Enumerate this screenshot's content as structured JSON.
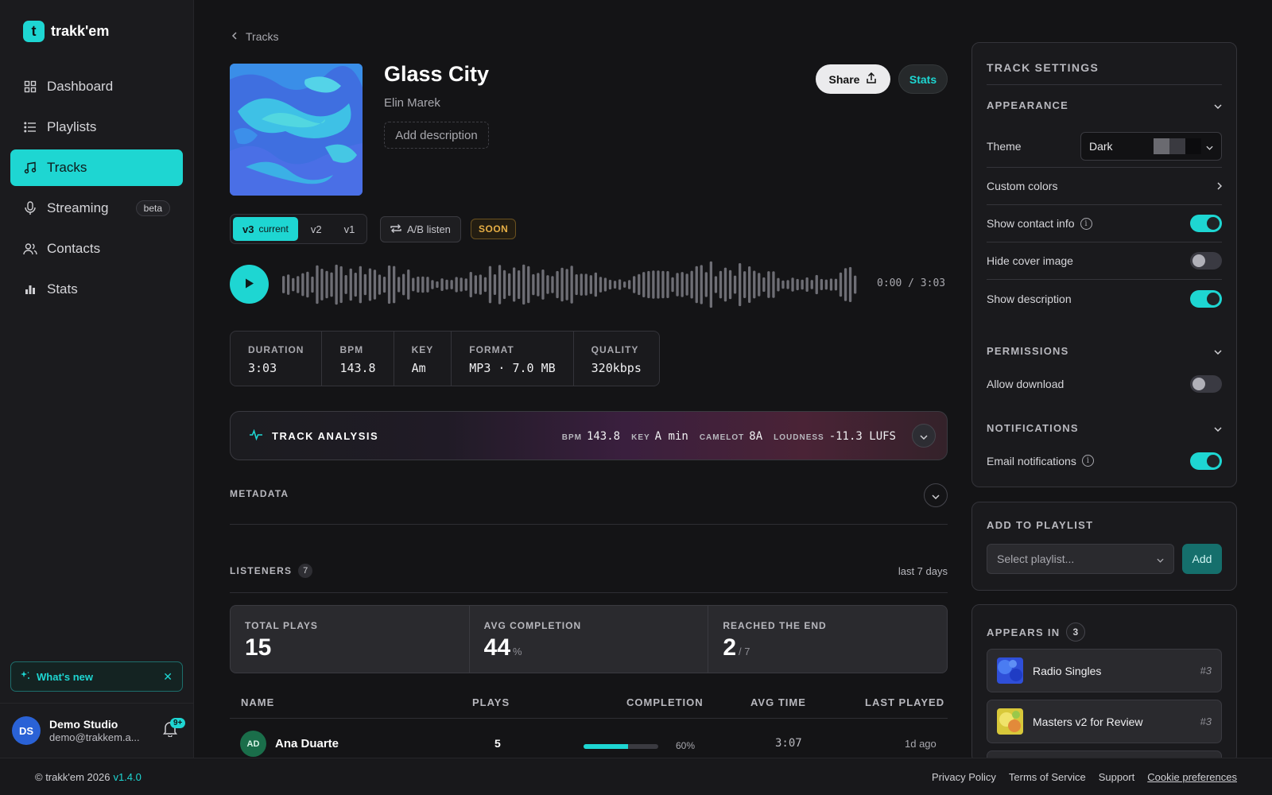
{
  "app": {
    "name": "trakk'em",
    "logo_letter": "t",
    "accent": "#1ed6d2"
  },
  "sidebar": {
    "items": [
      {
        "label": "Dashboard",
        "icon": "grid-icon"
      },
      {
        "label": "Playlists",
        "icon": "list-icon"
      },
      {
        "label": "Tracks",
        "icon": "music-note-icon",
        "active": true
      },
      {
        "label": "Streaming",
        "icon": "microphone-icon",
        "badge": "beta"
      },
      {
        "label": "Contacts",
        "icon": "users-icon"
      },
      {
        "label": "Stats",
        "icon": "bar-chart-icon"
      }
    ],
    "whats_new": "What's new",
    "user": {
      "initials": "DS",
      "name": "Demo Studio",
      "email": "demo@trakkem.a...",
      "notif_badge": "9+"
    }
  },
  "breadcrumb": {
    "label": "Tracks"
  },
  "track": {
    "title": "Glass City",
    "artist": "Elin Marek",
    "add_description": "Add description",
    "share": "Share",
    "stats": "Stats",
    "versions": [
      {
        "label": "v3",
        "sub": "current",
        "active": true
      },
      {
        "label": "v2"
      },
      {
        "label": "v1"
      }
    ],
    "ab_listen": "A/B listen",
    "soon": "SOON",
    "time": "0:00 / 3:03",
    "specs": [
      {
        "label": "DURATION",
        "value": "3:03"
      },
      {
        "label": "BPM",
        "value": "143.8"
      },
      {
        "label": "KEY",
        "value": "Am"
      },
      {
        "label": "FORMAT",
        "value": "MP3 · 7.0 MB"
      },
      {
        "label": "QUALITY",
        "value": "320kbps"
      }
    ]
  },
  "analysis": {
    "title": "TRACK ANALYSIS",
    "metrics": [
      {
        "label": "BPM",
        "value": "143.8"
      },
      {
        "label": "KEY",
        "value": "A min"
      },
      {
        "label": "CAMELOT",
        "value": "8A"
      },
      {
        "label": "LOUDNESS",
        "value": "-11.3 LUFS"
      }
    ]
  },
  "metadata": {
    "label": "METADATA"
  },
  "listeners": {
    "label": "LISTENERS",
    "count": "7",
    "range": "last 7 days",
    "stats": [
      {
        "label": "TOTAL PLAYS",
        "value": "15",
        "sub": ""
      },
      {
        "label": "AVG COMPLETION",
        "value": "44",
        "sub": "%"
      },
      {
        "label": "REACHED THE END",
        "value": "2",
        "sub": "/ 7"
      }
    ],
    "columns": [
      "NAME",
      "PLAYS",
      "COMPLETION",
      "AVG TIME",
      "LAST PLAYED"
    ],
    "rows": [
      {
        "initials": "AD",
        "name": "Ana Duarte",
        "plays": "5",
        "completion": 0.6,
        "completion_label": "60%",
        "avg_time": "3:07",
        "last_played": "1d ago"
      }
    ]
  },
  "settings": {
    "title": "TRACK SETTINGS",
    "appearance": {
      "label": "APPEARANCE",
      "theme_label": "Theme",
      "theme_value": "Dark",
      "custom_colors": "Custom colors",
      "show_contact_info": "Show contact info",
      "hide_cover_image": "Hide cover image",
      "show_description": "Show description"
    },
    "permissions": {
      "label": "PERMISSIONS",
      "allow_download": "Allow download"
    },
    "notifications": {
      "label": "NOTIFICATIONS",
      "email_notifications": "Email notifications"
    }
  },
  "add_to_playlist": {
    "title": "ADD TO PLAYLIST",
    "placeholder": "Select playlist...",
    "add": "Add"
  },
  "appears_in": {
    "title": "APPEARS IN",
    "count": "3",
    "items": [
      {
        "name": "Radio Singles",
        "rank": "#3"
      },
      {
        "name": "Masters v2 for Review",
        "rank": "#3"
      }
    ]
  },
  "footer": {
    "copyright": "© trakk'em 2026",
    "version": "v1.4.0",
    "links": [
      "Privacy Policy",
      "Terms of Service",
      "Support",
      "Cookie preferences"
    ]
  }
}
